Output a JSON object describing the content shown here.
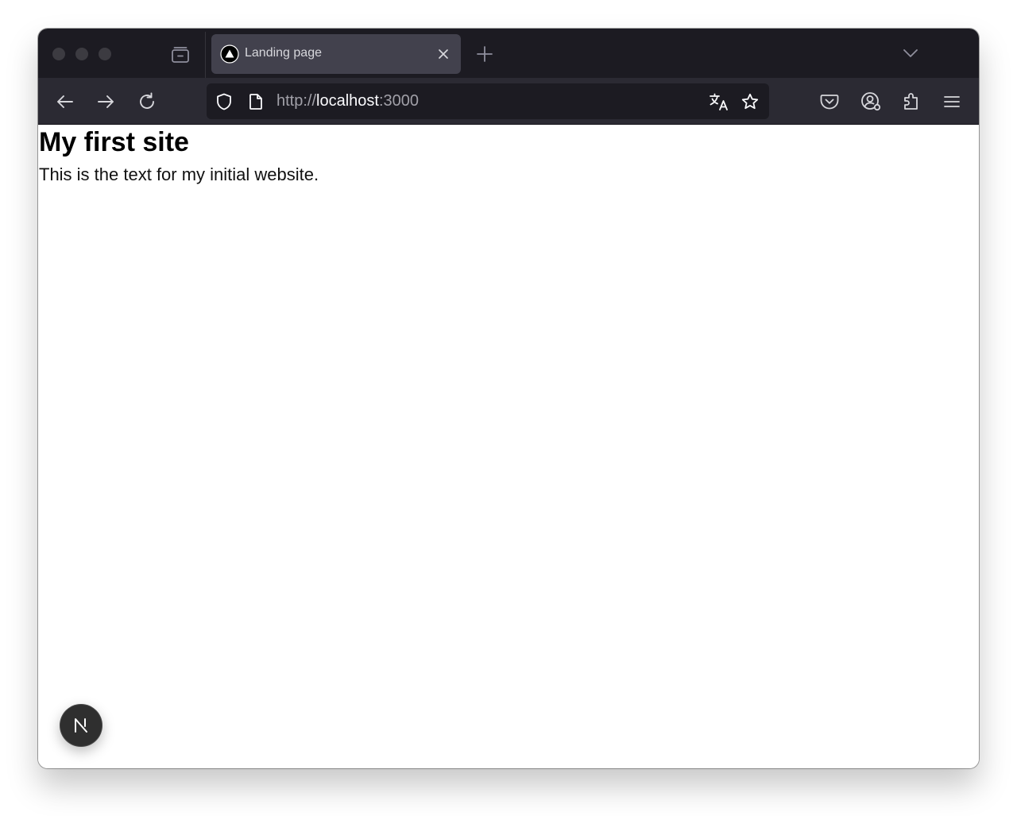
{
  "browser": {
    "tab": {
      "title": "Landing page",
      "favicon": "triangle-logo-icon",
      "close_icon": "close-icon"
    },
    "toolbar": {
      "back_icon": "back-arrow-icon",
      "forward_icon": "forward-arrow-icon",
      "reload_icon": "reload-icon"
    },
    "url": {
      "scheme": "http://",
      "host": "localhost",
      "port": ":3000"
    },
    "icons": [
      "tab-overview-icon",
      "new-tab-icon",
      "list-tabs-chevron-icon",
      "shield-icon",
      "page-icon",
      "translate-icon",
      "bookmark-star-icon",
      "pocket-icon",
      "account-icon",
      "extensions-icon",
      "menu-icon"
    ],
    "colors": {
      "chrome_dark": "#1c1b22",
      "toolbar": "#2b2a33",
      "active_tab": "#42414d",
      "url_text_dim": "#a1a0a8",
      "url_text_host": "#fbfbfe"
    }
  },
  "page": {
    "heading": "My first site",
    "text": "This is the text for my initial website.",
    "dev_badge": {
      "label": "N",
      "icon": "nextjs-dev-indicator-icon"
    }
  }
}
